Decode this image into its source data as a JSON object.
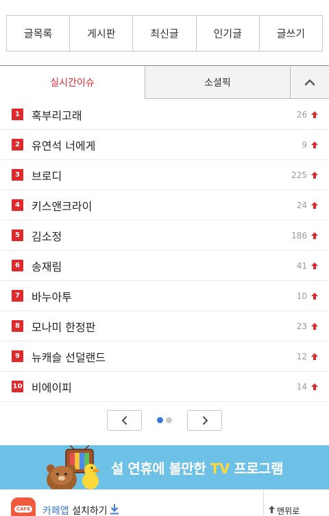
{
  "topnav": {
    "items": [
      "글목록",
      "게시판",
      "최신글",
      "인기글",
      "글쓰기"
    ]
  },
  "tabs": {
    "active": "실시간이슈",
    "inactive": "소셜픽"
  },
  "ranking": [
    {
      "rank": "1",
      "keyword": "혹부리고래",
      "count": "26"
    },
    {
      "rank": "2",
      "keyword": "유연석 너에게",
      "count": "9"
    },
    {
      "rank": "3",
      "keyword": "브로디",
      "count": "225"
    },
    {
      "rank": "4",
      "keyword": "키스앤크라이",
      "count": "24"
    },
    {
      "rank": "5",
      "keyword": "김소정",
      "count": "186"
    },
    {
      "rank": "6",
      "keyword": "송재림",
      "count": "41"
    },
    {
      "rank": "7",
      "keyword": "바누아투",
      "count": "10"
    },
    {
      "rank": "8",
      "keyword": "모나미 한정판",
      "count": "23"
    },
    {
      "rank": "9",
      "keyword": "뉴캐슬 선덜랜드",
      "count": "12"
    },
    {
      "rank": "10",
      "keyword": "비에이피",
      "count": "14"
    }
  ],
  "pager": {
    "pages": 2,
    "current": 1
  },
  "banner": {
    "text_before": "설 연휴에 볼만한 ",
    "text_highlight": "TV",
    "text_after": " 프로그램"
  },
  "footer": {
    "logo_text": "CAFE",
    "install_app": "카페앱",
    "install_rest": " 설치하기",
    "to_top": "맨위로"
  },
  "colors": {
    "accent_red": "#e0292d",
    "link_blue": "#3a77d8",
    "banner_bg": "#6ec1e6",
    "cafe_orange": "#f15a3d"
  },
  "icons": {
    "collapse": "chevron-up-icon",
    "rise": "up-arrow-icon",
    "prev": "chevron-left-icon",
    "next": "chevron-right-icon",
    "download": "download-icon",
    "to_top": "arrow-up-icon"
  }
}
